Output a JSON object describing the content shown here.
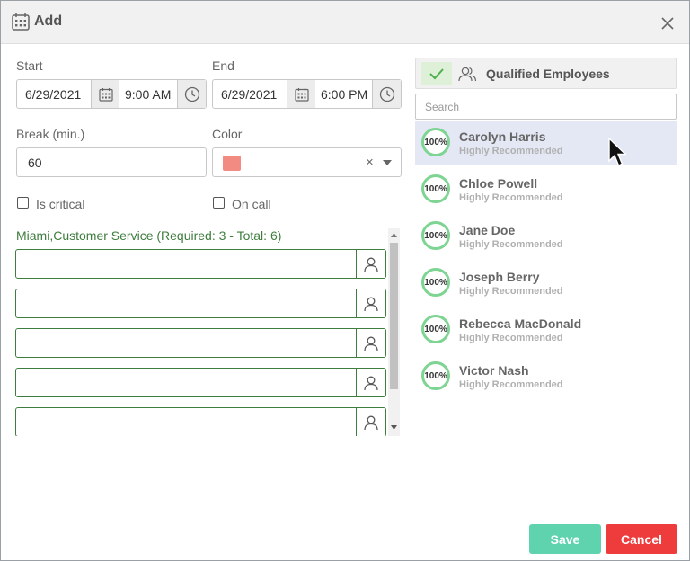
{
  "dialog": {
    "title": "Add",
    "icons": {
      "title": "calendar-grid-icon",
      "close": "close-icon"
    }
  },
  "form": {
    "start": {
      "label": "Start",
      "date": "6/29/2021",
      "time": "9:00 AM"
    },
    "end": {
      "label": "End",
      "date": "6/29/2021",
      "time": "6:00 PM"
    },
    "break": {
      "label": "Break (min.)",
      "value": "60"
    },
    "color": {
      "label": "Color",
      "swatch": "#f28b82",
      "clear_glyph": "×"
    },
    "is_critical": {
      "label": "Is critical",
      "checked": false
    },
    "on_call": {
      "label": "On call",
      "checked": false
    }
  },
  "group": {
    "title": "Miami,Customer Service (Required: 3 - Total: 6)",
    "slots": [
      "",
      "",
      "",
      "",
      ""
    ]
  },
  "qualified": {
    "title": "Qualified Employees",
    "search_placeholder": "Search",
    "employees": [
      {
        "name": "Carolyn Harris",
        "score": "100%",
        "status": "Highly Recommended",
        "selected": true
      },
      {
        "name": "Chloe Powell",
        "score": "100%",
        "status": "Highly Recommended"
      },
      {
        "name": "Jane Doe",
        "score": "100%",
        "status": "Highly Recommended"
      },
      {
        "name": "Joseph Berry",
        "score": "100%",
        "status": "Highly Recommended"
      },
      {
        "name": "Rebecca MacDonald",
        "score": "100%",
        "status": "Highly Recommended"
      },
      {
        "name": "Victor Nash",
        "score": "100%",
        "status": "Highly Recommended"
      }
    ]
  },
  "footer": {
    "save_label": "Save",
    "cancel_label": "Cancel"
  },
  "colors": {
    "accent_green": "#3e7d3e",
    "save": "#5fd3ae",
    "cancel": "#ee3b3b",
    "ring": "#7ed492"
  }
}
